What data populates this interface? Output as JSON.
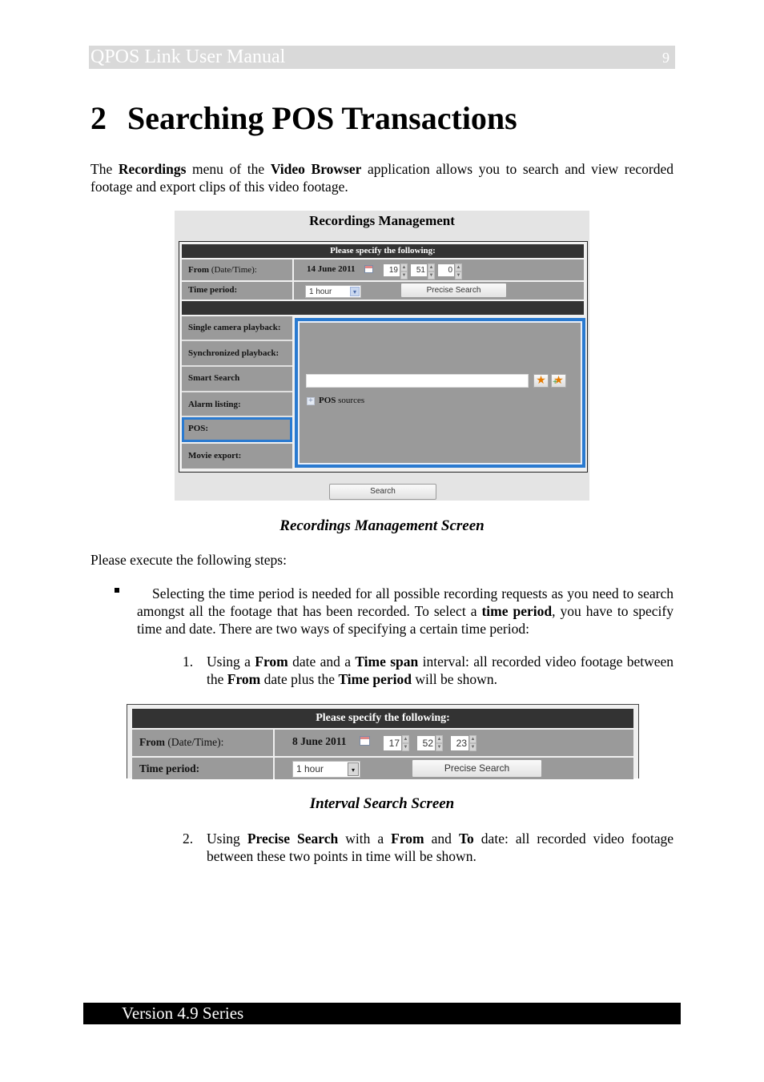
{
  "header": {
    "title": "QPOS Link User Manual",
    "page_number": "9"
  },
  "chapter": {
    "number": "2",
    "title": "Searching POS Transactions"
  },
  "intro": {
    "parts": [
      "The ",
      "Recordings",
      " menu of the ",
      "Video Browser",
      " application allows you to search and view recorded footage and export clips of this video footage."
    ]
  },
  "screenshot1": {
    "title": "Recordings Management",
    "header_row": "Please specify the following:",
    "from_label_bold": "From",
    "from_label_normal": " (Date/Time):",
    "from_date": "14 June 2011",
    "hour": "19",
    "minute": "51",
    "second": "0",
    "time_period_label": "Time period:",
    "time_period_value": "1 hour",
    "precise_search_label": "Precise Search",
    "side_items": [
      {
        "label": "Single camera playback:"
      },
      {
        "label": "Synchronized playback:"
      },
      {
        "label": "Smart Search"
      },
      {
        "label": "Alarm listing:"
      },
      {
        "label": "POS:",
        "selected": true
      },
      {
        "label": "Movie export:"
      }
    ],
    "search_input_value": "",
    "tree_node_bold": "POS",
    "tree_node_rest": " sources",
    "search_button_label": "Search"
  },
  "caption1": "Recordings Management Screen",
  "steps_intro": "Please execute the following steps:",
  "bullet": {
    "parts": [
      "Selecting the time period is needed for all possible recording requests as you need to search amongst all the footage that has been recorded. To select a ",
      "time period",
      ", you have to specify time and date. There are two ways of specifying a certain time period:"
    ]
  },
  "item1": {
    "number": "1.",
    "parts": [
      "Using a ",
      "From",
      " date and a ",
      "Time span",
      " interval: all recorded video footage between the ",
      "From",
      " date plus the ",
      "Time period",
      " will be shown."
    ]
  },
  "screenshot2": {
    "header_row": "Please specify the following:",
    "from_label_bold": "From",
    "from_label_normal": " (Date/Time):",
    "from_date": "8 June 2011",
    "hour": "17",
    "minute": "52",
    "second": "23",
    "time_period_label": "Time period:",
    "time_period_value": "1 hour",
    "precise_search_label": "Precise Search"
  },
  "caption2": "Interval Search Screen",
  "item2": {
    "number": "2.",
    "parts": [
      "Using ",
      "Precise Search",
      " with a ",
      "From",
      " and ",
      "To",
      " date: all recorded video footage between these two points in time will be shown."
    ]
  },
  "footer": {
    "text": "Version 4.9 Series"
  }
}
